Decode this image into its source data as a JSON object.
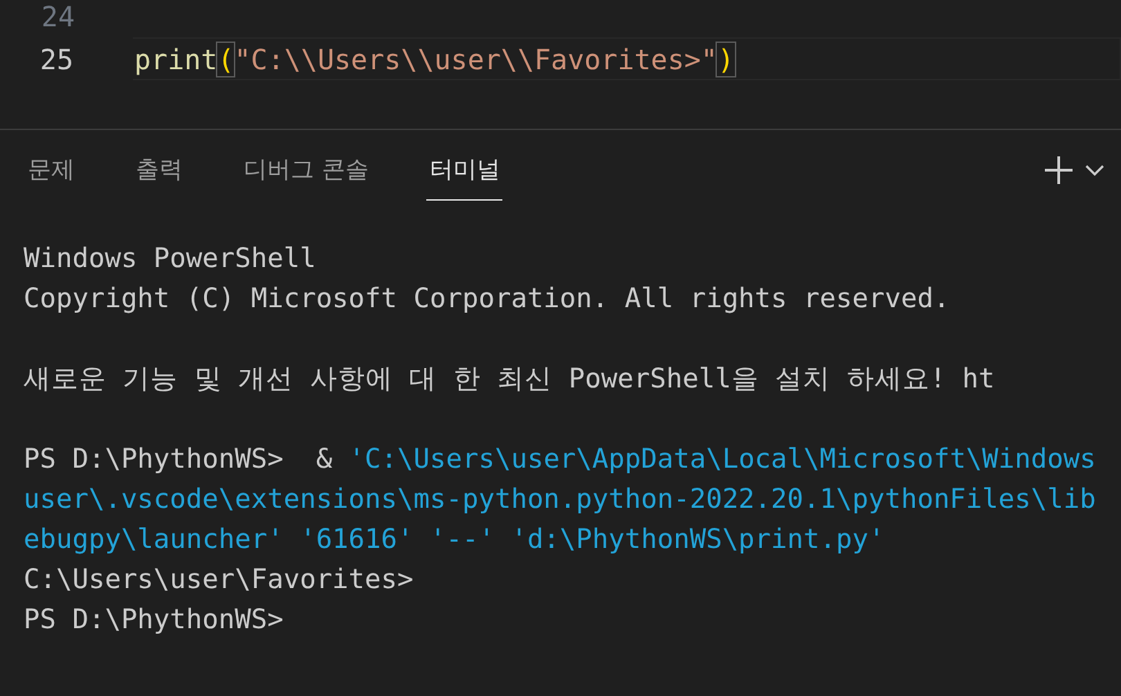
{
  "editor": {
    "lines": [
      {
        "number": "24",
        "current": false
      },
      {
        "number": "25",
        "current": true,
        "tokens": [
          {
            "kind": "function",
            "text": "print"
          },
          {
            "kind": "bracket",
            "text": "("
          },
          {
            "kind": "string",
            "text": "\"C:\\\\Users\\\\user\\\\Favorites>\""
          },
          {
            "kind": "bracket",
            "text": ")"
          }
        ]
      }
    ]
  },
  "panel": {
    "tabs": [
      {
        "label": "문제",
        "selected": false
      },
      {
        "label": "출력",
        "selected": false
      },
      {
        "label": "디버그 콘솔",
        "selected": false
      },
      {
        "label": "터미널",
        "selected": true
      }
    ]
  },
  "terminal": {
    "paragraphs": [
      {
        "lines": [
          [
            {
              "kind": "plain",
              "text": "Windows PowerShell"
            }
          ],
          [
            {
              "kind": "plain",
              "text": "Copyright (C) Microsoft Corporation. All rights reserved."
            }
          ]
        ]
      },
      {
        "lines": [
          [
            {
              "kind": "plain",
              "text": "새로운 기능 및 개선 사항에 대 한 최신 PowerShell을 설치 하세요! ht"
            }
          ]
        ]
      },
      {
        "lines": [
          [
            {
              "kind": "plain",
              "text": "PS D:\\PhythonWS>  & "
            },
            {
              "kind": "string",
              "text": "'C:\\Users\\user\\AppData\\Local\\Microsoft\\Windows"
            }
          ],
          [
            {
              "kind": "string",
              "text": "user\\.vscode\\extensions\\ms-python.python-2022.20.1\\pythonFiles\\lib"
            }
          ],
          [
            {
              "kind": "string",
              "text": "ebugpy\\launcher' '61616' '--' 'd:\\PhythonWS\\print.py'"
            }
          ],
          [
            {
              "kind": "plain",
              "text": "C:\\Users\\user\\Favorites>"
            }
          ],
          [
            {
              "kind": "plain",
              "text": "PS D:\\PhythonWS>"
            }
          ]
        ]
      }
    ]
  }
}
